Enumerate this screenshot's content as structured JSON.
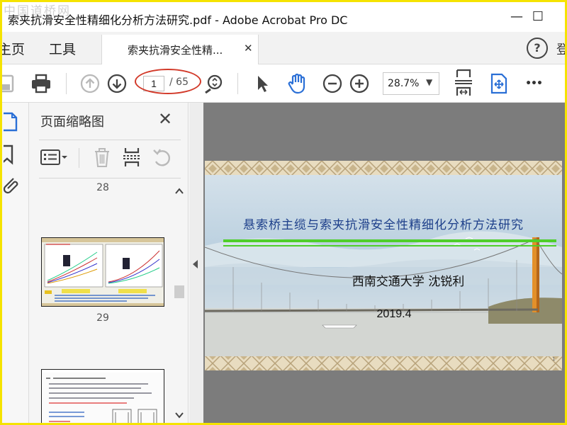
{
  "window": {
    "title": "索夹抗滑安全性精细化分析方法研究.pdf - Adobe Acrobat Pro DC",
    "watermark": "中国道桥网",
    "min_symbol": "—",
    "max_symbol": "☐"
  },
  "tabs": {
    "home": "主页",
    "tools": "工具",
    "document": "索夹抗滑安全性精...",
    "close_symbol": "✕",
    "help_symbol": "?",
    "overflow_text": "登"
  },
  "toolbar": {
    "current_page": "1",
    "total_pages": "/ 65",
    "zoom": "28.7%",
    "zoom_caret": "▼",
    "more_symbol": "•••"
  },
  "thumbnails": {
    "title": "页面缩略图",
    "close_symbol": "✕",
    "pages": [
      "28",
      "29"
    ]
  },
  "slide": {
    "title": "悬索桥主缆与索夹抗滑安全性精细化分析方法研究",
    "author": "西南交通大学  沈锐利",
    "date": "2019.4",
    "page_number": "1"
  },
  "colors": {
    "accent_blue": "#2a6fd6",
    "window_border": "#f5e300",
    "annotation_red": "#d23a2a",
    "slide_title": "#1d3f8a",
    "slide_rule": "#4fce2b"
  },
  "icons": [
    "save-icon",
    "print-icon",
    "prev-page-icon",
    "next-page-icon",
    "zoom-page-icon",
    "select-arrow-icon",
    "hand-icon",
    "zoom-out-icon",
    "zoom-in-icon",
    "fit-height-icon",
    "full-screen-icon",
    "more-icon",
    "thumbnails-icon",
    "bookmark-icon",
    "attachment-icon",
    "options-icon",
    "delete-icon",
    "insert-page-icon",
    "rotate-icon"
  ]
}
